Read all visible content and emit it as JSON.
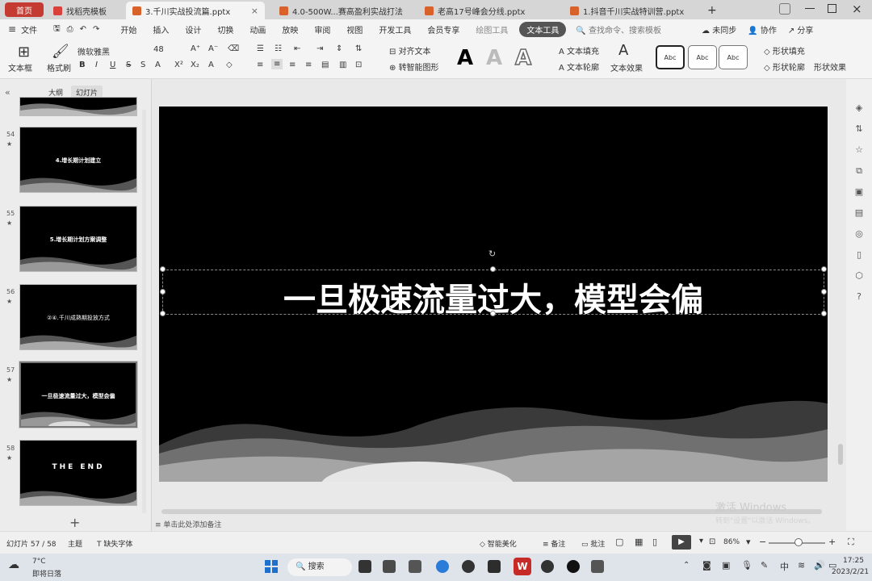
{
  "tabs": {
    "home": "首页",
    "items": [
      {
        "label": "找稻壳模板",
        "color": "#d9413a"
      },
      {
        "label": "3.千川实战投流篇.pptx",
        "color": "#d9622b"
      },
      {
        "label": "4.0-500W...赛高盈利实战打法",
        "color": "#d9622b"
      },
      {
        "label": "老高17号峰会分线.pptx",
        "color": "#d9622b"
      },
      {
        "label": "1.抖音千川实战特训营.pptx",
        "color": "#d9622b"
      }
    ],
    "add": "+"
  },
  "menu": {
    "file": "文件",
    "items": [
      "开始",
      "插入",
      "设计",
      "切换",
      "动画",
      "放映",
      "审阅",
      "视图",
      "开发工具",
      "会员专享",
      "绘图工具",
      "文本工具"
    ],
    "active": "文本工具",
    "search": "查找命令、搜索模板",
    "sync": "未同步",
    "collab": "协作",
    "share": "分享"
  },
  "ribbon": {
    "textbox": "文本框",
    "format_painter": "格式刷",
    "font_name": "微软雅黑",
    "font_size": "48",
    "align_text": "对齐文本",
    "smart_shape": "转智能图形",
    "text_fill": "文本填充",
    "text_outline": "文本轮廓",
    "text_effect": "文本效果",
    "shape_fill": "形状填充",
    "shape_outline": "形状轮廓",
    "shape_effect": "形状效果",
    "abc": "Abc"
  },
  "panel": {
    "tab_outline": "大纲",
    "tab_slides": "幻灯片",
    "add": "+"
  },
  "thumbnails": [
    {
      "num": "54",
      "title": "4.增长期计划建立"
    },
    {
      "num": "55",
      "title": "5.增长期计划方案调整"
    },
    {
      "num": "56",
      "title": "②④.千川成熟期投放方式"
    },
    {
      "num": "57",
      "title": "一旦极速流量过大，模型会偏"
    },
    {
      "num": "58",
      "title": "THE END"
    }
  ],
  "slide": {
    "title": "一旦极速流量过大，模型会偏"
  },
  "notes": {
    "placeholder": "单击此处添加备注"
  },
  "status": {
    "slide_counter": "幻灯片 57 / 58",
    "theme": "主题",
    "missing_font": "缺失字体",
    "smart_beautify": "智能美化",
    "notes_btn": "备注",
    "comment_btn": "批注",
    "zoom": "86%"
  },
  "watermark": {
    "line1": "激活 Windows",
    "line2": "转到\"设置\"以激活 Windows。"
  },
  "taskbar": {
    "weather_temp": "7°C",
    "weather_desc": "即将日落",
    "search": "搜索",
    "ime": "中",
    "time": "17:25",
    "date": "2023/2/21"
  }
}
